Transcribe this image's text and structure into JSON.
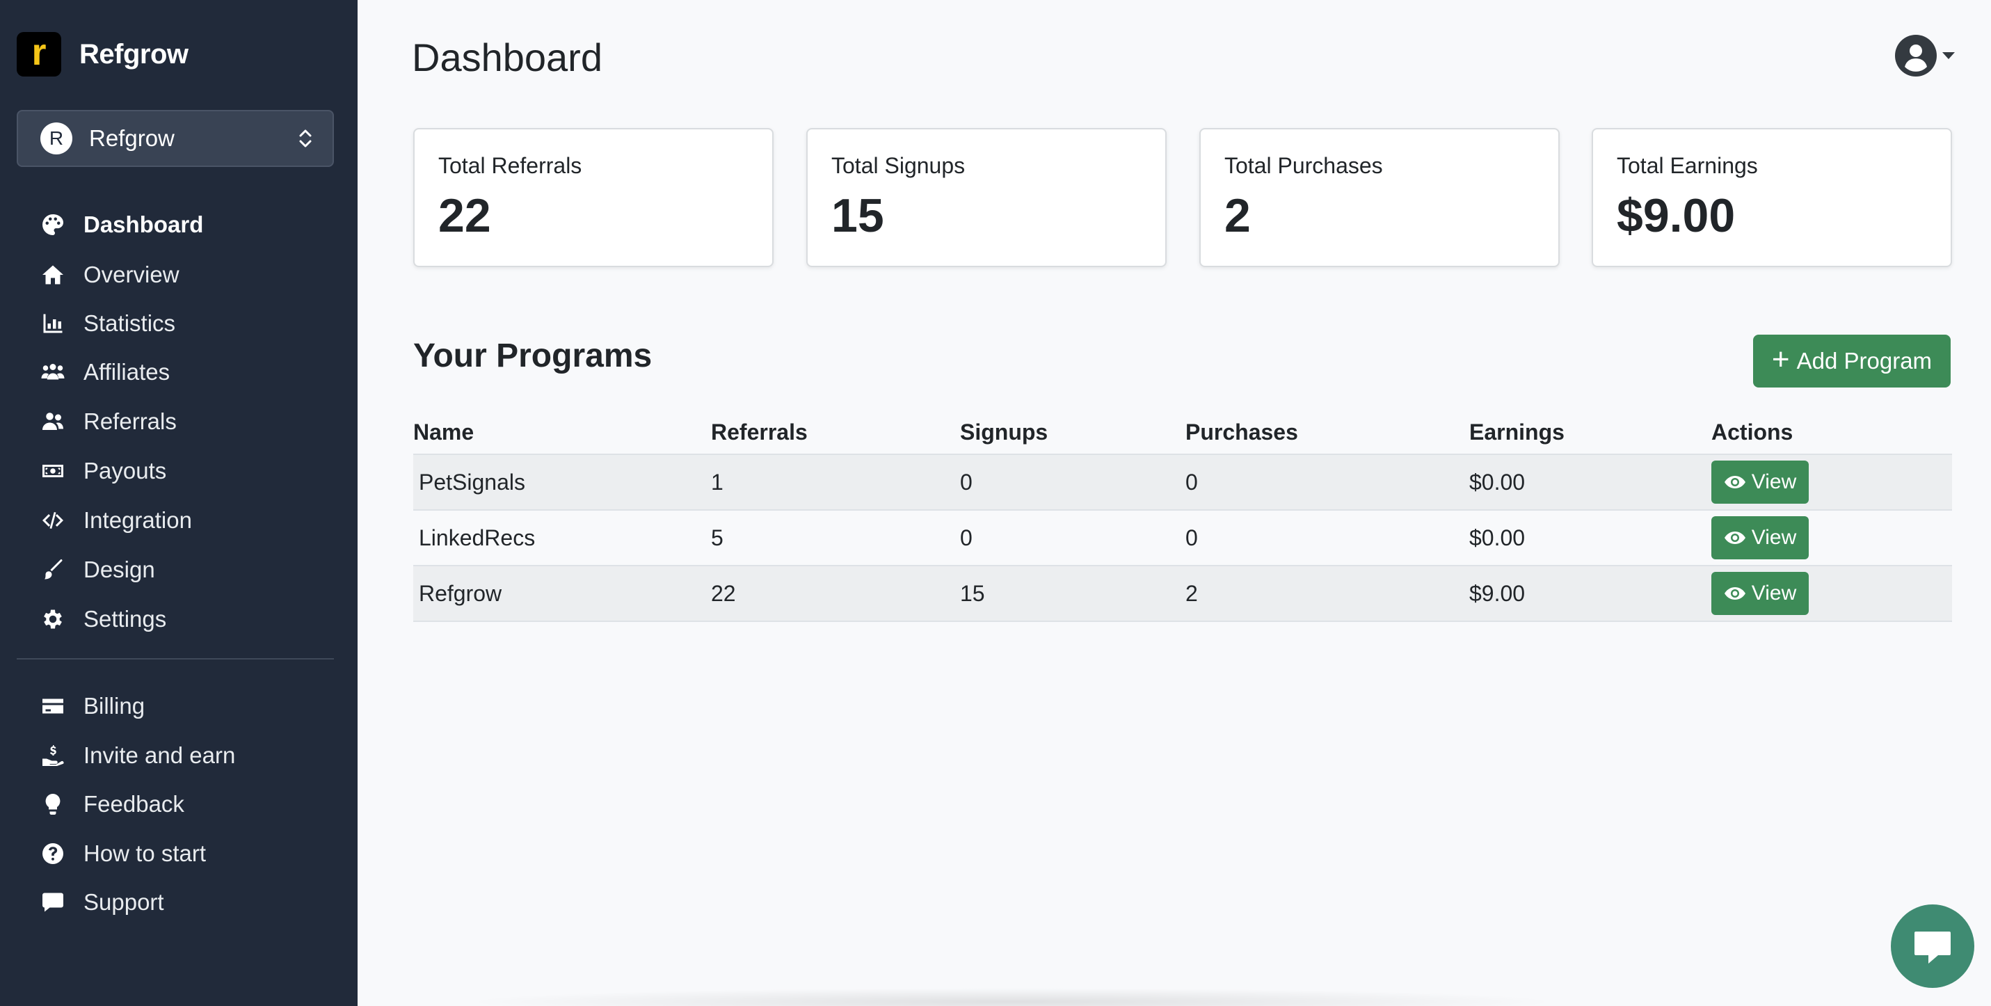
{
  "brand": {
    "logo_letter": "r",
    "name": "Refgrow",
    "logo_letter_color": "#f5c518"
  },
  "program_switcher": {
    "avatar_letter": "R",
    "label": "Refgrow"
  },
  "nav": {
    "primary": [
      {
        "label": "Dashboard",
        "icon": "palette-icon",
        "active": true
      },
      {
        "label": "Overview",
        "icon": "home-icon"
      },
      {
        "label": "Statistics",
        "icon": "bar-chart-icon"
      },
      {
        "label": "Affiliates",
        "icon": "users-icon"
      },
      {
        "label": "Referrals",
        "icon": "user-group-icon"
      },
      {
        "label": "Payouts",
        "icon": "money-icon"
      },
      {
        "label": "Integration",
        "icon": "code-icon"
      },
      {
        "label": "Design",
        "icon": "brush-icon"
      },
      {
        "label": "Settings",
        "icon": "gear-icon"
      }
    ],
    "secondary": [
      {
        "label": "Billing",
        "icon": "credit-card-icon"
      },
      {
        "label": "Invite and earn",
        "icon": "hand-dollar-icon"
      },
      {
        "label": "Feedback",
        "icon": "lightbulb-icon"
      },
      {
        "label": "How to start",
        "icon": "question-circle-icon"
      },
      {
        "label": "Support",
        "icon": "chat-icon"
      }
    ]
  },
  "page": {
    "title": "Dashboard"
  },
  "stats": [
    {
      "label": "Total Referrals",
      "value": "22"
    },
    {
      "label": "Total Signups",
      "value": "15"
    },
    {
      "label": "Total Purchases",
      "value": "2"
    },
    {
      "label": "Total Earnings",
      "value": "$9.00"
    }
  ],
  "programs": {
    "title": "Your Programs",
    "add_button": {
      "plus": "+",
      "label": "Add Program"
    },
    "columns": [
      "Name",
      "Referrals",
      "Signups",
      "Purchases",
      "Earnings",
      "Actions"
    ],
    "rows": [
      {
        "name": "PetSignals",
        "referrals": "1",
        "signups": "0",
        "purchases": "0",
        "earnings": "$0.00",
        "action": "View"
      },
      {
        "name": "LinkedRecs",
        "referrals": "5",
        "signups": "0",
        "purchases": "0",
        "earnings": "$0.00",
        "action": "View"
      },
      {
        "name": "Refgrow",
        "referrals": "22",
        "signups": "15",
        "purchases": "2",
        "earnings": "$9.00",
        "action": "View"
      }
    ]
  },
  "colors": {
    "sidebar": "#212a3a",
    "accent_green": "#3d8b57",
    "chat_bubble": "#3f8b72"
  }
}
